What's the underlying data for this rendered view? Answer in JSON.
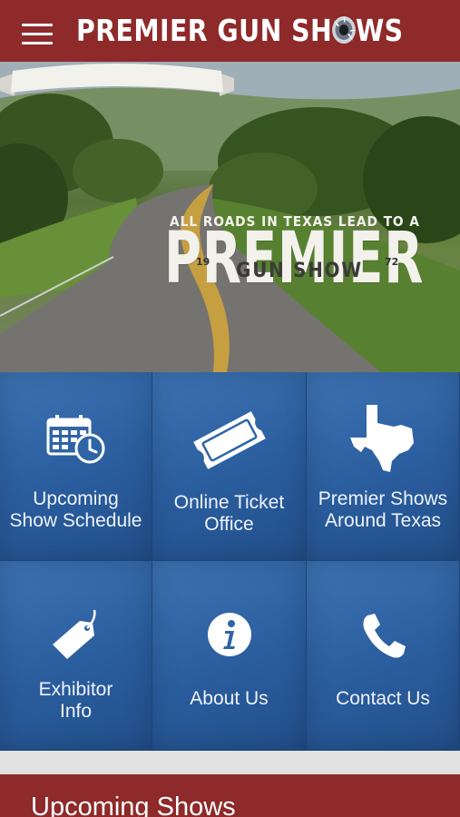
{
  "header": {
    "logo_text_1": "PREMIER GUN SH",
    "logo_text_2": "WS",
    "brand_color": "#8e2a2a"
  },
  "hero": {
    "tagline": "ALL ROADS IN TEXAS LEAD TO A",
    "headline": "PREMIER",
    "ribbon_text": "GUN SHOW",
    "year_left": "19",
    "year_right": "72"
  },
  "tiles": [
    {
      "line1": "Upcoming",
      "line2": "Show Schedule",
      "icon": "calendar-clock-icon"
    },
    {
      "line1": "Online Ticket",
      "line2": "Office",
      "icon": "ticket-icon"
    },
    {
      "line1": "Premier Shows",
      "line2": "Around Texas",
      "icon": "texas-map-icon"
    },
    {
      "line1": "Exhibitor",
      "line2": "Info",
      "icon": "tag-icon"
    },
    {
      "line1": "About Us",
      "line2": "",
      "icon": "info-icon"
    },
    {
      "line1": "Contact Us",
      "line2": "",
      "icon": "phone-icon"
    }
  ],
  "section": {
    "title": "Upcoming Shows"
  },
  "colors": {
    "tile_blue": "#2a5d9e",
    "header_red": "#8e2a2a"
  }
}
